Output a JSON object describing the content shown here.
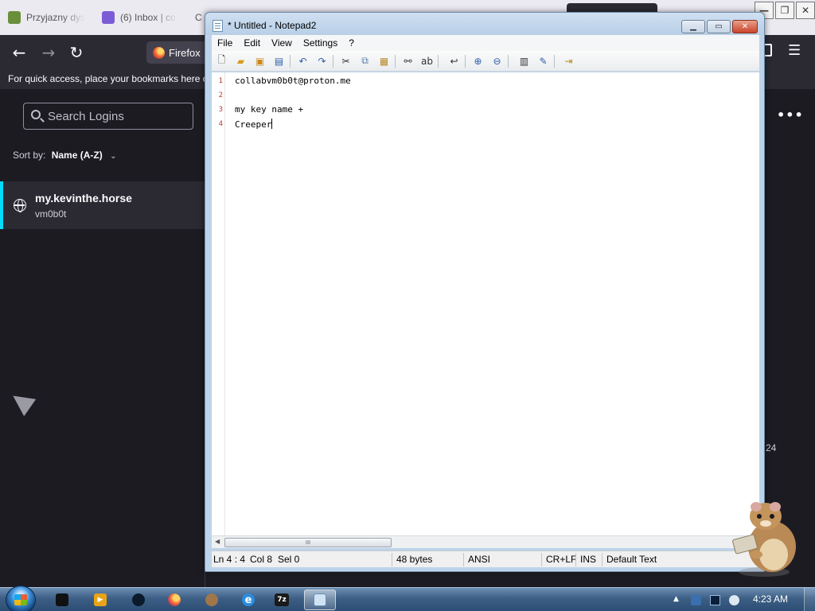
{
  "firefox": {
    "tabs": [
      {
        "label": "Przyjazny dys",
        "favicon_color": "#6a8f3a"
      },
      {
        "label": "(6) Inbox | col",
        "favicon_color": "#7b5cd6"
      },
      {
        "label": "C",
        "favicon_color": "#999999"
      }
    ],
    "urlbar_label": "Firefox",
    "bookmarks_hint": "For quick access, place your bookmarks here o",
    "search_placeholder": "Search Logins",
    "sort_label": "Sort by:",
    "sort_value": "Name (A-Z)",
    "login_site": "my.kevinthe.horse",
    "login_username": "vm0b0t",
    "count_partial": "24",
    "accent_color": "#00ddff"
  },
  "notepad": {
    "title": "* Untitled - Notepad2",
    "menu": [
      "File",
      "Edit",
      "View",
      "Settings",
      "?"
    ],
    "toolbar_icons": [
      "new-icon",
      "open-icon",
      "browse-icon",
      "save-icon",
      "undo-icon",
      "redo-icon",
      "cut-icon",
      "copy-icon",
      "paste-icon",
      "find-icon",
      "replace-icon",
      "word-wrap-icon",
      "zoom-in-icon",
      "zoom-out-icon",
      "scheme-icon",
      "customize-icon",
      "exit-icon"
    ],
    "lines": [
      {
        "num": "1",
        "text": "collabvm0b0t@proton.me"
      },
      {
        "num": "2",
        "text": ""
      },
      {
        "num": "3",
        "text": "my key name +"
      },
      {
        "num": "4",
        "text": "Creeper"
      }
    ],
    "status": {
      "position": "Ln 4 : 4",
      "col": "Col 8",
      "sel": "Sel 0",
      "size": "48 bytes",
      "encoding": "ANSI",
      "eol": "CR+LF",
      "mode": "INS",
      "scheme": "Default Text"
    },
    "scroll_grip": "III"
  },
  "taskbar": {
    "clock": "4:23 AM",
    "apps": [
      {
        "name": "cmd-icon",
        "color": "#111111",
        "glyph": ""
      },
      {
        "name": "media-player-icon",
        "color": "#e8a317",
        "glyph": "▶"
      },
      {
        "name": "app-circle-icon",
        "color": "#0b1a2a",
        "glyph": ""
      },
      {
        "name": "firefox-icon",
        "color": "#ff7139",
        "glyph": ""
      },
      {
        "name": "hamster-app-icon",
        "color": "#a0764a",
        "glyph": ""
      },
      {
        "name": "internet-explorer-icon",
        "color": "#2b8de0",
        "glyph": "e"
      },
      {
        "name": "7zip-icon",
        "color": "#1a1a1a",
        "glyph": "7z"
      },
      {
        "name": "notepad2-icon",
        "color": "#cfe3f5",
        "glyph": ""
      }
    ]
  }
}
